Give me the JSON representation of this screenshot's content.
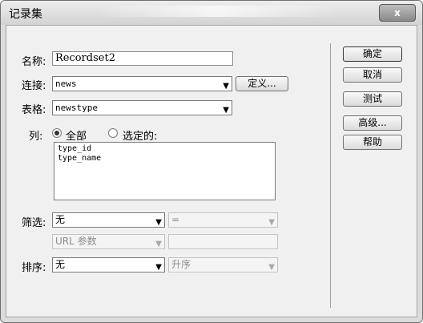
{
  "window": {
    "title": "记录集",
    "close_label": "x"
  },
  "form": {
    "name_label": "名称:",
    "name_value": "Recordset2",
    "connection_label": "连接:",
    "connection_value": "news",
    "define_button": "定义...",
    "table_label": "表格:",
    "table_value": "newstype",
    "columns_label": "列:",
    "columns_all": "全部",
    "columns_selected": "选定的:",
    "columns_list": [
      "type_id",
      "type_name"
    ],
    "filter_label": "筛选:",
    "filter_field": "无",
    "filter_operator": "=",
    "filter_source": "URL 参数",
    "filter_value": "",
    "sort_label": "排序:",
    "sort_field": "无",
    "sort_order": "升序"
  },
  "buttons": {
    "ok": "确定",
    "cancel": "取消",
    "test": "测试",
    "advanced": "高级...",
    "help": "帮助"
  },
  "icons": {
    "close": "close-icon",
    "dropdown": "chevron-down-icon"
  }
}
